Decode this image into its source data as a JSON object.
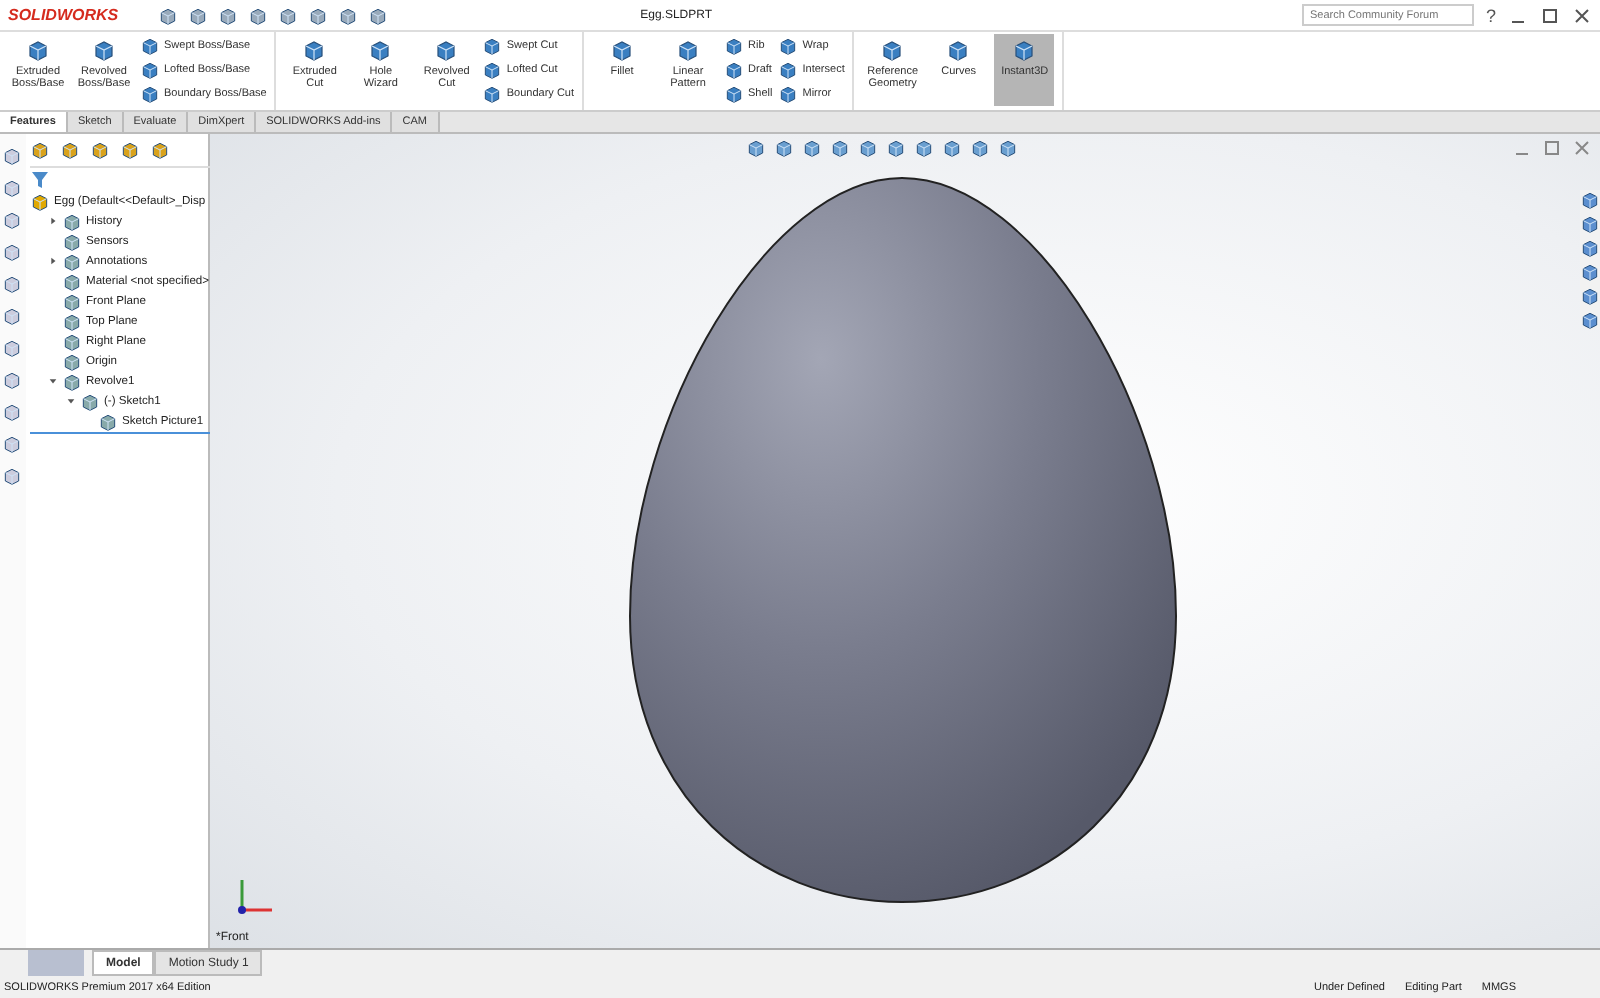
{
  "title_bar": {
    "logo": "SOLIDWORKS",
    "document_title": "Egg.SLDPRT",
    "search": {
      "placeholder": "Search Community Forum"
    },
    "help": "?"
  },
  "ribbon": {
    "groups": [
      {
        "items": [
          {
            "label": "Extruded Boss/Base",
            "kind": "large",
            "selected": false
          },
          {
            "label": "Revolved Boss/Base",
            "kind": "large",
            "selected": false
          },
          {
            "label": "Swept Boss/Base",
            "kind": "small",
            "selected": false
          },
          {
            "label": "Lofted Boss/Base",
            "kind": "small",
            "selected": false
          },
          {
            "label": "Boundary Boss/Base",
            "kind": "small",
            "selected": false
          }
        ]
      },
      {
        "items": [
          {
            "label": "Extruded Cut",
            "kind": "large",
            "selected": false
          },
          {
            "label": "Hole Wizard",
            "kind": "large",
            "selected": false
          },
          {
            "label": "Revolved Cut",
            "kind": "large",
            "selected": false
          },
          {
            "label": "Swept Cut",
            "kind": "small",
            "selected": false
          },
          {
            "label": "Lofted Cut",
            "kind": "small",
            "selected": false
          },
          {
            "label": "Boundary Cut",
            "kind": "small",
            "selected": false
          }
        ]
      },
      {
        "items": [
          {
            "label": "Fillet",
            "kind": "large",
            "selected": false
          },
          {
            "label": "Linear Pattern",
            "kind": "large",
            "selected": false
          },
          {
            "label": "Rib",
            "kind": "small",
            "selected": false
          },
          {
            "label": "Draft",
            "kind": "small",
            "selected": false
          },
          {
            "label": "Shell",
            "kind": "small",
            "selected": false
          },
          {
            "label": "Wrap",
            "kind": "small",
            "selected": false
          },
          {
            "label": "Intersect",
            "kind": "small",
            "selected": false
          },
          {
            "label": "Mirror",
            "kind": "small",
            "selected": false
          }
        ]
      },
      {
        "items": [
          {
            "label": "Reference Geometry",
            "kind": "large",
            "selected": false
          },
          {
            "label": "Curves",
            "kind": "large",
            "selected": false
          },
          {
            "label": "Instant3D",
            "kind": "large",
            "selected": true
          }
        ]
      }
    ]
  },
  "command_tabs": [
    {
      "label": "Features",
      "selected": true
    },
    {
      "label": "Sketch",
      "selected": false
    },
    {
      "label": "Evaluate",
      "selected": false
    },
    {
      "label": "DimXpert",
      "selected": false
    },
    {
      "label": "SOLIDWORKS Add-ins",
      "selected": false
    },
    {
      "label": "CAM",
      "selected": false
    }
  ],
  "feature_tree": {
    "root": "Egg  (Default<<Default>_Disp",
    "items": [
      {
        "label": "History",
        "expanded": false
      },
      {
        "label": "Sensors"
      },
      {
        "label": "Annotations",
        "expanded": false
      },
      {
        "label": "Material <not specified>"
      },
      {
        "label": "Front Plane"
      },
      {
        "label": "Top Plane"
      },
      {
        "label": "Right Plane"
      },
      {
        "label": "Origin"
      },
      {
        "label": "Revolve1",
        "expanded": true,
        "children": [
          {
            "label": "(-) Sketch1",
            "expanded": true,
            "children": [
              {
                "label": "Sketch Picture1"
              }
            ]
          }
        ]
      }
    ]
  },
  "viewport": {
    "view_label": "*Front"
  },
  "bottom_tabs": [
    {
      "label": "Model",
      "selected": true
    },
    {
      "label": "Motion Study 1",
      "selected": false
    }
  ],
  "status_bar": {
    "product": "SOLIDWORKS Premium 2017 x64 Edition",
    "state": "Under Defined",
    "mode": "Editing Part",
    "units": "MMGS"
  }
}
